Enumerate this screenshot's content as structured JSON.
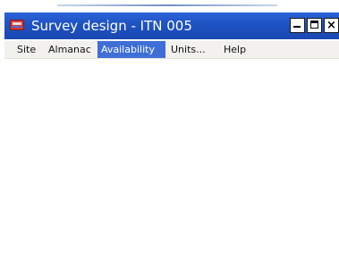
{
  "window": {
    "title": "Survey design - ITN 005",
    "app_icon": "app-icon",
    "buttons": {
      "minimize_icon": "minimize-icon",
      "maximize_icon": "maximize-icon",
      "close_label": "×"
    }
  },
  "menubar": {
    "items": [
      {
        "label": "Site",
        "active": false
      },
      {
        "label": "Almanac",
        "active": false
      },
      {
        "label": "Availability",
        "active": true
      },
      {
        "label": "Units...",
        "active": false
      },
      {
        "label": "Help",
        "active": false
      }
    ]
  },
  "colors": {
    "titlebar": "#1e52c2",
    "menu_highlight": "#3f6fd6",
    "menubar_bg": "#f2f1ed"
  }
}
